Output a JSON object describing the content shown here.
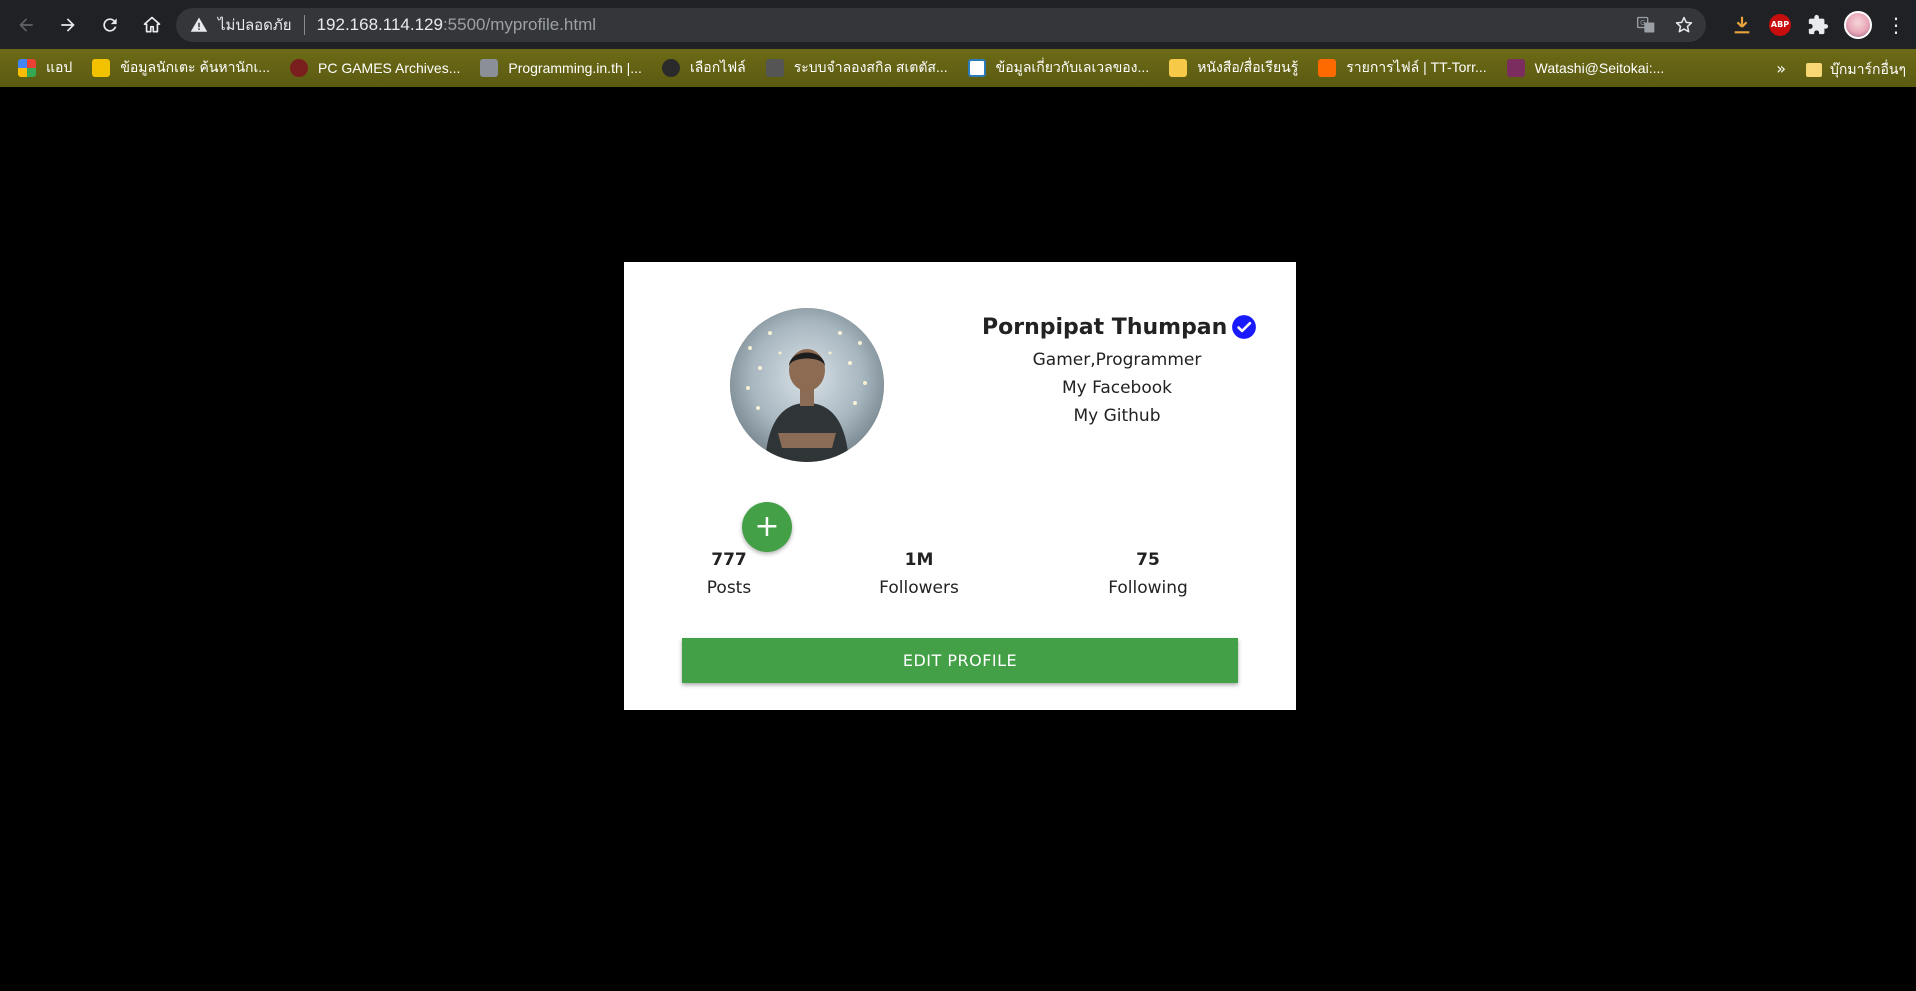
{
  "browser": {
    "address_bar": {
      "security_label": "ไม่ปลอดภัย",
      "host": "192.168.114.129",
      "path": ":5500/myprofile.html"
    },
    "bookmarks": [
      {
        "label": "แอป",
        "color": "#e94235"
      },
      {
        "label": "ข้อมูลนักเตะ ค้นหานักเ...",
        "color": "#f2c200"
      },
      {
        "label": "PC GAMES Archives...",
        "color": "#7b1e1e"
      },
      {
        "label": "Programming.in.th |...",
        "color": "#8b8f98"
      },
      {
        "label": "เลือกไฟล์",
        "color": "#3a3a3a"
      },
      {
        "label": "ระบบจำลองสกิล สเตตัส...",
        "color": "#555555"
      },
      {
        "label": "ข้อมูลเกี่ยวกับเลเวลของ...",
        "color": "#2b7bb9"
      },
      {
        "label": "หนังสือ/สื่อเรียนรู้",
        "color": "#f7c948"
      },
      {
        "label": "รายการไฟล์ | TT-Torr...",
        "color": "#ff6a00"
      },
      {
        "label": "Watashi@Seitokai:...",
        "color": "#7a2d5e"
      }
    ],
    "bookmarks_more": "»",
    "bookmarks_folder": "บุ๊กมาร์กอื่นๆ",
    "abp_label": "ABP"
  },
  "profile": {
    "name": "Pornpipat Thumpan",
    "bio": "Gamer,Programmer",
    "links": [
      "My Facebook",
      "My Github"
    ],
    "add_button": "+",
    "stats": [
      {
        "value": "777",
        "label": "Posts"
      },
      {
        "value": "1M",
        "label": "Followers"
      },
      {
        "value": "75",
        "label": "Following"
      }
    ],
    "edit_button": "EDIT PROFILE"
  },
  "colors": {
    "accent_green": "#43a047",
    "verified_blue": "#1a1aff",
    "bookmark_bar": "#6d6b16"
  }
}
